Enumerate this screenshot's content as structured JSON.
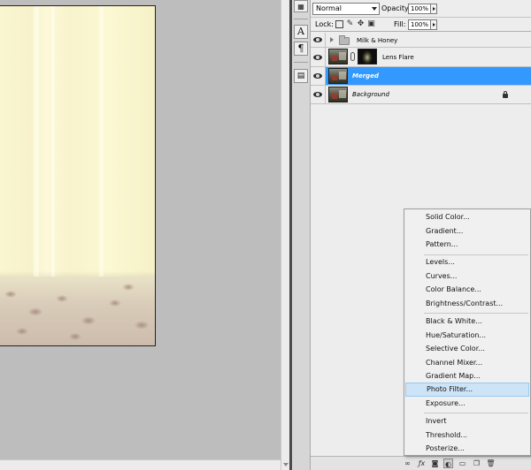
{
  "layers_panel": {
    "blend_mode": "Normal",
    "opacity_label": "Opacity:",
    "opacity_value": "100%",
    "lock_label": "Lock:",
    "fill_label": "Fill:",
    "fill_value": "100%",
    "layers": [
      {
        "name": "Milk & Honey",
        "type": "group",
        "visible": true,
        "selected": false
      },
      {
        "name": "Lens Flare",
        "type": "adjustment-masked",
        "visible": true,
        "selected": false
      },
      {
        "name": "Merged",
        "type": "pixel",
        "visible": true,
        "selected": true
      },
      {
        "name": "Background",
        "type": "pixel-locked",
        "visible": true,
        "selected": false
      }
    ]
  },
  "adjustment_menu": {
    "items": [
      {
        "label": "Solid Color..."
      },
      {
        "label": "Gradient..."
      },
      {
        "label": "Pattern..."
      },
      {
        "label": "Levels..."
      },
      {
        "label": "Curves..."
      },
      {
        "label": "Color Balance..."
      },
      {
        "label": "Brightness/Contrast..."
      },
      {
        "label": "Black & White..."
      },
      {
        "label": "Hue/Saturation..."
      },
      {
        "label": "Selective Color..."
      },
      {
        "label": "Channel Mixer..."
      },
      {
        "label": "Gradient Map..."
      },
      {
        "label": "Photo Filter...",
        "highlighted": true
      },
      {
        "label": "Exposure..."
      },
      {
        "label": "Invert"
      },
      {
        "label": "Threshold..."
      },
      {
        "label": "Posterize..."
      }
    ]
  },
  "tools": {
    "character_glyph": "A",
    "paragraph_glyph": "¶"
  },
  "colors": {
    "selection": "#3399ff",
    "menu_highlight": "#cde4f7",
    "panel_bg": "#ededed",
    "workspace_bg": "#bdbdbd"
  },
  "icons": [
    "eye-icon",
    "folder-icon",
    "chain-icon",
    "lock-icon",
    "transparency-lock-icon",
    "brush-lock-icon",
    "move-lock-icon",
    "link-icon",
    "fx-icon",
    "mask-icon",
    "adjustment-layer-icon",
    "new-group-icon",
    "new-layer-icon",
    "trash-icon"
  ]
}
